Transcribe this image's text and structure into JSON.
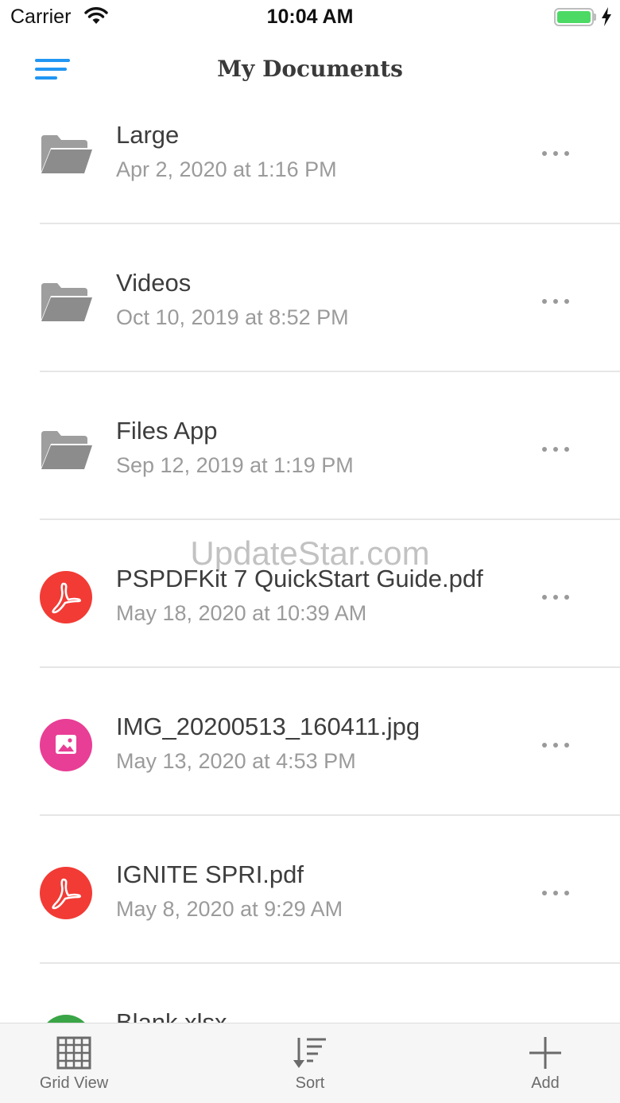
{
  "status_bar": {
    "carrier": "Carrier",
    "time": "10:04 AM",
    "battery_level": 1.0,
    "battery_color": "#4cd964"
  },
  "nav": {
    "title": "My Documents",
    "menu_icon": "hamburger-icon",
    "accent_color": "#2196f3"
  },
  "items": [
    {
      "title": "Large",
      "date": "Apr 2, 2020 at 1:16 PM",
      "kind": "folder",
      "icon": "folder-icon"
    },
    {
      "title": "Videos",
      "date": "Oct 10, 2019 at 8:52 PM",
      "kind": "folder",
      "icon": "folder-icon"
    },
    {
      "title": "Files App",
      "date": "Sep 12, 2019 at 1:19 PM",
      "kind": "folder",
      "icon": "folder-icon"
    },
    {
      "title": "PSPDFKit 7 QuickStart Guide.pdf",
      "date": "May 18, 2020 at 10:39 AM",
      "kind": "pdf",
      "icon": "pdf-icon",
      "color": "#f23b35"
    },
    {
      "title": "IMG_20200513_160411.jpg",
      "date": "May 13, 2020 at 4:53 PM",
      "kind": "image",
      "icon": "image-icon",
      "color": "#e83e96"
    },
    {
      "title": "IGNITE SPRI.pdf",
      "date": "May 8, 2020 at 9:29 AM",
      "kind": "pdf",
      "icon": "pdf-icon",
      "color": "#f23b35"
    },
    {
      "title": "Blank.xlsx",
      "date": "",
      "kind": "spreadsheet",
      "icon": "spreadsheet-icon",
      "color": "#3aa546"
    }
  ],
  "watermark": "UpdateStar.com",
  "tab_bar": {
    "grid_view": "Grid View",
    "sort": "Sort",
    "add": "Add"
  }
}
